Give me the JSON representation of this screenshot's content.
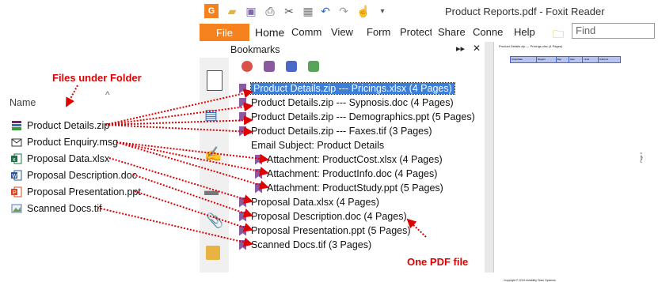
{
  "annotations": {
    "files_label": "Files under Folder",
    "pdf_label": "One PDF file"
  },
  "explorer": {
    "column_header": "Name",
    "files": [
      {
        "name": "Product Details.zip",
        "icon": "zip-icon"
      },
      {
        "name": "Product Enquiry.msg",
        "icon": "mail-icon"
      },
      {
        "name": "Proposal Data.xlsx",
        "icon": "excel-icon"
      },
      {
        "name": "Proposal Description.doc",
        "icon": "word-icon"
      },
      {
        "name": "Proposal Presentation.ppt",
        "icon": "powerpoint-icon"
      },
      {
        "name": "Scanned Docs.tif",
        "icon": "image-icon"
      }
    ]
  },
  "window": {
    "title": "Product Reports.pdf - Foxit Reader",
    "file_tab": "File",
    "menu": [
      "Home",
      "Comm",
      "View",
      "Form",
      "Protect",
      "Share",
      "Conne",
      "Help"
    ],
    "find_placeholder": "Find"
  },
  "bookmarks": {
    "header": "Bookmarks",
    "items": [
      {
        "label": "Product Details.zip --- Pricings.xlsx (4 Pages)",
        "selected": true,
        "flag": true
      },
      {
        "label": "Product Details.zip --- Sypnosis.doc (4 Pages)",
        "flag": true
      },
      {
        "label": "Product Details.zip --- Demographics.ppt (5 Pages)",
        "flag": true
      },
      {
        "label": "Product Details.zip --- Faxes.tif (3 Pages)",
        "flag": true
      },
      {
        "label": "Email Subject: Product Details",
        "flag": false
      },
      {
        "label": "Attachment: ProductCost.xlsx (4 Pages)",
        "flag": true
      },
      {
        "label": "Attachment: ProductInfo.doc (4 Pages)",
        "flag": true
      },
      {
        "label": "Attachment: ProductStudy.ppt (5 Pages)",
        "flag": true
      },
      {
        "label": "Proposal Data.xlsx (4 Pages)",
        "flag": true
      },
      {
        "label": "Proposal Description.doc (4 Pages)",
        "flag": true
      },
      {
        "label": "Proposal Presentation.ppt (5 Pages)",
        "flag": true
      },
      {
        "label": "Scanned Docs.tif (3 Pages)",
        "flag": true
      }
    ]
  },
  "pdf_page": {
    "header": "Product Details.zip --- Pricings.xlsx (4 Pages)",
    "columns": [
      "OrderDate",
      "Region",
      "Rep",
      "Item",
      "Units",
      "UnitCost"
    ],
    "footer": "Copyright © 2019 Aviability Team Systems.",
    "side_text": "Page 2"
  },
  "colors": {
    "accent": "#f5821f",
    "annotation": "#e00000",
    "selection": "#3c7fd8",
    "bookmark_flag": "#8a5aa0"
  }
}
